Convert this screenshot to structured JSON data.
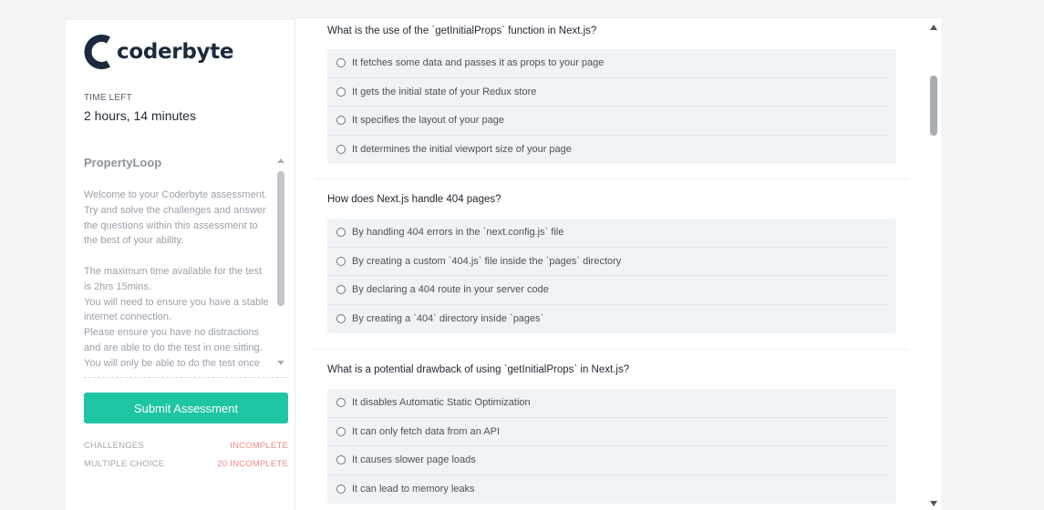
{
  "sidebar": {
    "logo_text": "coderbyte",
    "time_left_label": "TIME LEFT",
    "time_left_value": "2 hours, 14 minutes",
    "company": "PropertyLoop",
    "description": "Welcome to your Coderbyte assessment. Try and solve the challenges and answer the questions within this assessment to the best of your ability.\n\nThe maximum time available for the test is 2hrs 15mins.\nYou will need to ensure you have a stable internet connection.\nPlease ensure you have no distractions and are able to do the test in one sitting.\nYou will only be able to do the test once",
    "submit_label": "Submit Assessment",
    "stats": [
      {
        "label": "CHALLENGES",
        "value": "INCOMPLETE"
      },
      {
        "label": "MULTIPLE CHOICE",
        "value": "20 INCOMPLETE"
      }
    ]
  },
  "questions": [
    {
      "text": "What is the use of the `getInitialProps` function in Next.js?",
      "options": [
        "It fetches some data and passes it as props to your page",
        "It gets the initial state of your Redux store",
        "It specifies the layout of your page",
        "It determines the initial viewport size of your page"
      ]
    },
    {
      "text": "How does Next.js handle 404 pages?",
      "options": [
        "By handling 404 errors in the `next.config.js` file",
        "By creating a custom `404.js` file inside the `pages` directory",
        "By declaring a 404 route in your server code",
        "By creating a `404` directory inside `pages`"
      ]
    },
    {
      "text": "What is a potential drawback of using `getInitialProps` in Next.js?",
      "options": [
        "It disables Automatic Static Optimization",
        "It can only fetch data from an API",
        "It causes slower page loads",
        "It can lead to memory leaks"
      ]
    }
  ],
  "colors": {
    "accent": "#1ec5a3",
    "incomplete": "#ef8a86",
    "logo": "#1b2a3c"
  },
  "icons": [
    "coderbyte-logo-icon",
    "radio-icon",
    "scroll-up-icon",
    "scroll-down-icon"
  ]
}
